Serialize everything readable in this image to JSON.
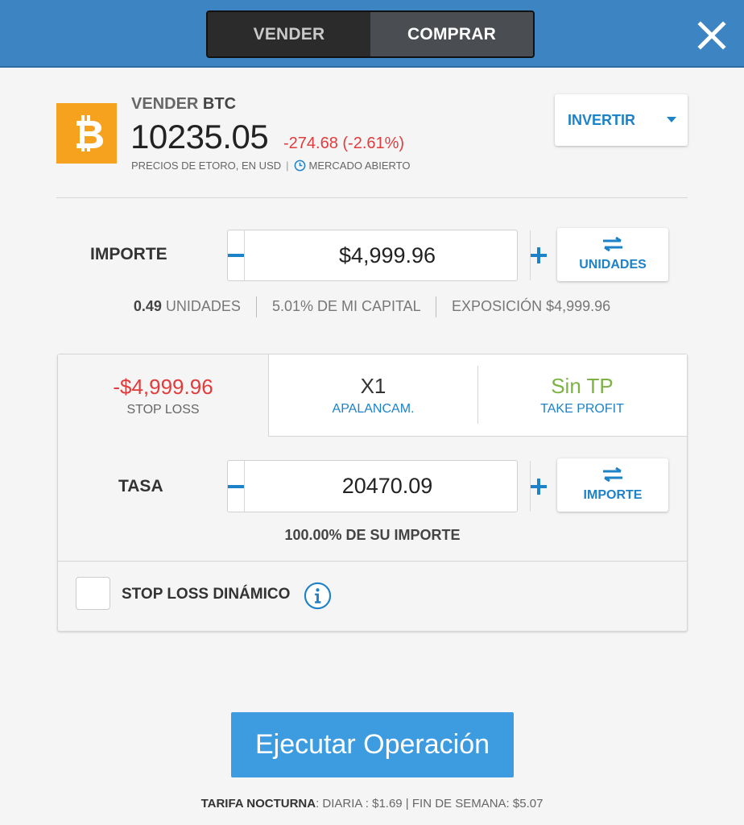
{
  "header": {
    "sell_label": "VENDER",
    "buy_label": "COMPRAR"
  },
  "instrument": {
    "action": "VENDER",
    "symbol": "BTC",
    "price": "10235.05",
    "change": "-274.68 (-2.61%)",
    "price_source": "PRECIOS DE ETORO, EN USD",
    "market_status": "MERCADO ABIERTO",
    "invert_label": "INVERTIR"
  },
  "amount": {
    "label": "IMPORTE",
    "value": "$4,999.96",
    "toggle_label": "UNIDADES",
    "units_value": "0.49",
    "units_label": "UNIDADES",
    "capital": "5.01% DE MI CAPITAL",
    "exposure": "EXPOSICIÓN $4,999.96"
  },
  "tabs": {
    "stop_loss_value": "-$4,999.96",
    "stop_loss_label": "STOP LOSS",
    "leverage_value": "X1",
    "leverage_label": "APALANCAM.",
    "take_profit_value": "Sin TP",
    "take_profit_label": "TAKE PROFIT"
  },
  "rate": {
    "label": "TASA",
    "value": "20470.09",
    "toggle_label": "IMPORTE",
    "info": "100.00% DE SU IMPORTE"
  },
  "dynamic_sl": {
    "label": "STOP LOSS DINÁMICO"
  },
  "execute_label": "Ejecutar Operación",
  "fees": {
    "label": "TARIFA NOCTURNA",
    "text": ": DIARIA : $1.69 | FIN DE SEMANA: $5.07"
  },
  "colors": {
    "header": "#3d84c2",
    "accent": "#1d82c7",
    "negative": "#e23b3b",
    "positive": "#7cb342",
    "execute": "#3d9be0",
    "bitcoin": "#f7a21e"
  }
}
